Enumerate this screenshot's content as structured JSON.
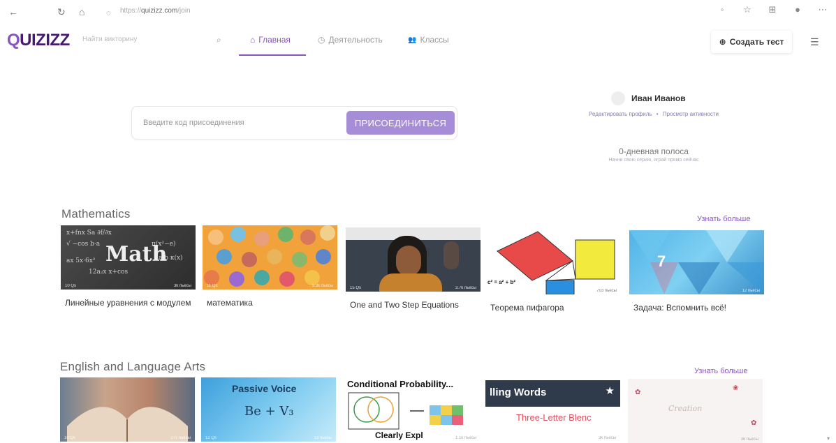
{
  "browser": {
    "back_icon": "←",
    "reload_icon": "↻",
    "home_icon": "⌂",
    "lock_icon": "◌",
    "url_prefix": "https://",
    "url_host": "quizizz.com",
    "url_path": "/join"
  },
  "header": {
    "logo_q": "Q",
    "logo_rest": "UIZIZZ",
    "search_placeholder": "Найти викторину",
    "tabs": [
      {
        "icon": "⌂",
        "label": "Главная"
      },
      {
        "icon": "◷",
        "label": "Деятельность"
      },
      {
        "icon": "👥",
        "label": "Классы"
      }
    ],
    "create_icon": "⊕",
    "create_label": "Создать тест",
    "accent": "#8854c0"
  },
  "join": {
    "placeholder": "Введите код присоединения",
    "button_label": "ПРИСОЕДИНИТЬСЯ"
  },
  "profile": {
    "name": "Иван Иванов",
    "edit_link": "Редактировать профиль",
    "activity_link": "Просмотр активности",
    "separator": "•",
    "streak": "0-дневная полоса",
    "streak_sub": "Начни свою серию, играй прямо сейчас"
  },
  "sections": [
    {
      "title": "Mathematics",
      "more": "Узнать больше",
      "cards": [
        {
          "title": "Линейные уравнения с модулем",
          "q": "10 Qs",
          "plays": "3k пьесы"
        },
        {
          "title": "математика",
          "q": "11 Qs",
          "plays": "2.3k пьесы"
        },
        {
          "title": "One and Two Step Equations",
          "q": "15 Qs",
          "plays": "3.7k пьесы"
        },
        {
          "title": "Теорема пифагора",
          "q": "12 Qs",
          "plays": "703 пьесы"
        },
        {
          "title": "Задача: Вспомнить всё!",
          "q": "10 Qs",
          "plays": "12 пьесы"
        }
      ]
    },
    {
      "title": "English and Language Arts",
      "more": "Узнать больше",
      "cards": [
        {
          "title": "",
          "q": "10 Qs",
          "plays": "271 пьесы"
        },
        {
          "title": "",
          "q": "12 Qs",
          "plays": "13 пьесы"
        },
        {
          "title": "",
          "q": "10 Qs",
          "plays": "1.1k пьесы"
        },
        {
          "title": "",
          "q": "11 Qs",
          "plays": "3k пьесы"
        },
        {
          "title": "",
          "q": "10 Qs",
          "plays": "36 пьесы"
        }
      ]
    }
  ],
  "thumb_text": {
    "math_big": "Math",
    "pyth_formula": "c² = a² + b²",
    "passive_a": "Passive Voice",
    "passive_b": "Be + V₃",
    "cond_a": "Conditional Probability...",
    "cond_b": "Clearly Expl",
    "spell_a": "lling Words",
    "spell_b": "Three-Letter Blenc",
    "floral": "Creation",
    "blue_num": "7"
  }
}
